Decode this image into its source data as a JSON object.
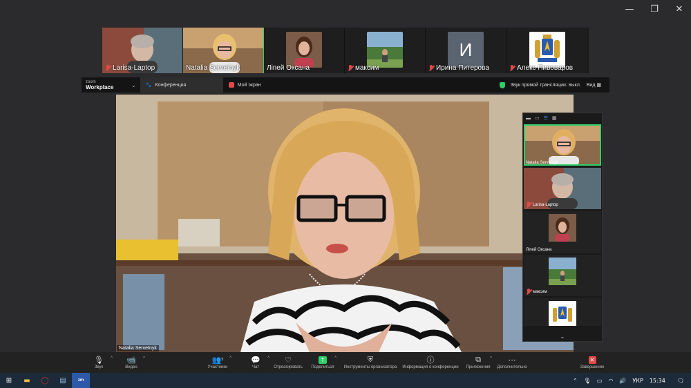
{
  "window_controls": {
    "minimize": "—",
    "restore": "❐",
    "close": "✕"
  },
  "participants": [
    {
      "name": "Larisa-Laptop",
      "muted": true,
      "active": false
    },
    {
      "name": "Natalia Servetnyk",
      "muted": false,
      "active": true
    },
    {
      "name": "Лiпей Оксана",
      "muted": false,
      "active": false
    },
    {
      "name": "максим",
      "muted": true,
      "active": false
    },
    {
      "name": "Ирина Питерова",
      "muted": true,
      "active": false,
      "initial": "И"
    },
    {
      "name": "Алекс Пивоваров",
      "muted": true,
      "active": false
    }
  ],
  "sharebar": {
    "logo_top": "zoom",
    "logo_bottom": "Workplace",
    "tab_conference": "Конференция",
    "tab_myscreen": "Мой экран",
    "stream_status": "Звук прямой трансляции: выкл.",
    "view_label": "Вид"
  },
  "stage": {
    "speaker_name": "Natalia Servetnyk"
  },
  "gallery": {
    "tiles": [
      {
        "name": "Natalia Servetnyk",
        "muted": false,
        "active": true
      },
      {
        "name": "Larisa-Laptop",
        "muted": true,
        "active": false
      },
      {
        "name": "Лiпей Оксана",
        "muted": false,
        "active": false
      },
      {
        "name": "максим",
        "muted": true,
        "active": false
      },
      {
        "name": "",
        "muted": false,
        "active": false
      }
    ]
  },
  "controls": {
    "audio": "Звук",
    "video": "Видео",
    "participants": "Участники",
    "participants_count": "5",
    "chat": "Чат",
    "react": "Отреагировать",
    "share": "Поделиться",
    "host_tools": "Инструменты организатора",
    "info": "Информация о конференции",
    "apps": "Приложения",
    "more": "Дополнительно",
    "end": "Завершение"
  },
  "taskbar": {
    "language": "УКР",
    "time": "15:34"
  },
  "colors": {
    "active_border": "#2fce6a",
    "muted_red": "#e24a4a",
    "share_green": "#2fce6a"
  }
}
